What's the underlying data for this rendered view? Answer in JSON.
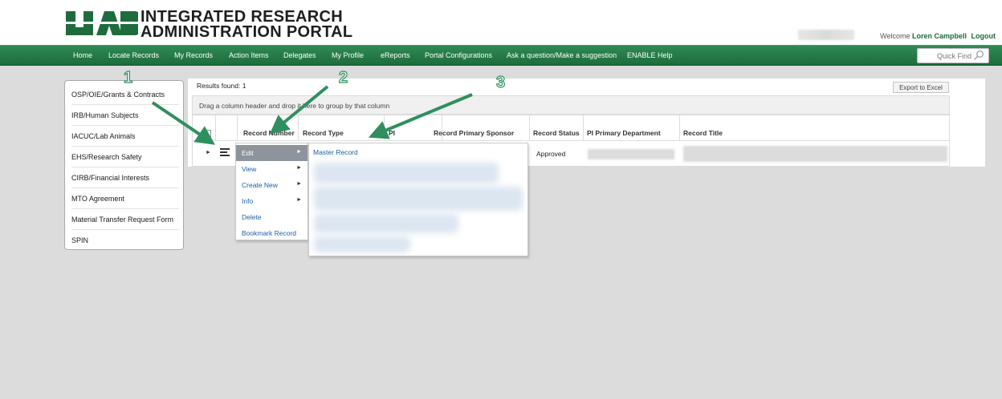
{
  "header": {
    "logo_text": "UAB",
    "title_line1": "INTEGRATED RESEARCH",
    "title_line2": "ADMINISTRATION PORTAL",
    "welcome_prefix": "Welcome",
    "user_name": "Loren Campbell",
    "logout": "Logout"
  },
  "nav": {
    "items": [
      "Home",
      "Locate Records",
      "My Records",
      "Action Items",
      "Delegates",
      "My Profile",
      "eReports",
      "Portal Configurations",
      "Ask a question/Make a suggestion",
      "ENABLE Help"
    ],
    "quick_find_placeholder": "Quick Find"
  },
  "sidebar": {
    "items": [
      "OSP/OIE/Grants & Contracts",
      "IRB/Human Subjects",
      "IACUC/Lab Animals",
      "EHS/Research Safety",
      "CIRB/Financial Interests",
      "MTO Agreement",
      "Material Transfer Request Form",
      "SPIN"
    ]
  },
  "grid": {
    "results_found": "Results found: 1",
    "export_label": "Export to Excel",
    "group_hint": "Drag a column header and drop it here to group by that column",
    "columns": [
      "Record Number",
      "Record Type",
      "PI",
      "Record Primary Sponsor",
      "Record Status",
      "PI Primary Department",
      "Record Title"
    ],
    "row": {
      "status": "Approved"
    }
  },
  "context_menu": {
    "items": [
      "Edit",
      "View",
      "Create New",
      "Info",
      "Delete",
      "Bookmark Record"
    ],
    "submenu_item": "Master Record"
  },
  "callouts": [
    "1",
    "2",
    "3"
  ],
  "colors": {
    "brand_green": "#1e6c3d",
    "arrow_green": "#2f8f5f",
    "link_blue": "#1a5fa8"
  }
}
